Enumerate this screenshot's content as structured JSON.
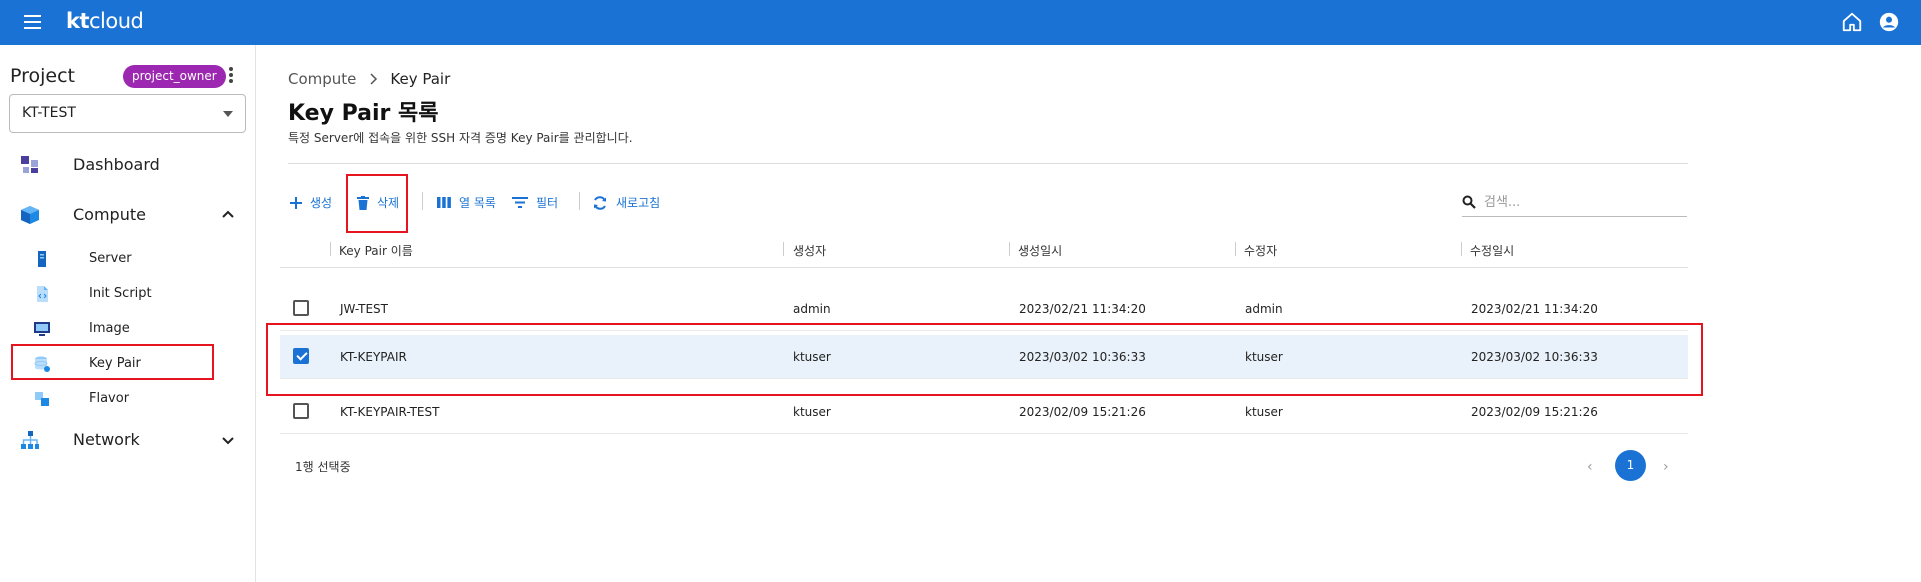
{
  "app": {
    "brand": "kt",
    "brand_suffix": "cloud",
    "accent": "#1a73d4"
  },
  "sidebar": {
    "project_label": "Project",
    "role_badge": "project_owner",
    "project_value": "KT-TEST",
    "items": [
      {
        "label": "Dashboard",
        "icon": "dashboard-icon"
      },
      {
        "label": "Compute",
        "icon": "compute-cube-icon",
        "expanded": true,
        "children": [
          {
            "label": "Server",
            "icon": "server-icon"
          },
          {
            "label": "Init Script",
            "icon": "script-file-icon"
          },
          {
            "label": "Image",
            "icon": "monitor-icon"
          },
          {
            "label": "Key Pair",
            "icon": "database-key-icon",
            "highlighted": true
          },
          {
            "label": "Flavor",
            "icon": "flavor-icon"
          }
        ]
      },
      {
        "label": "Network",
        "icon": "network-icon",
        "expanded": false
      }
    ]
  },
  "main": {
    "breadcrumb": [
      "Compute",
      "Key Pair"
    ],
    "title": "Key Pair 목록",
    "description": "특정 Server에 접속을 위한 SSH 자격 증명 Key Pair를 관리합니다.",
    "toolbar": {
      "create": "생성",
      "delete": "삭제",
      "columns": "열 목록",
      "filter": "필터",
      "refresh": "새로고침",
      "search_placeholder": "검색..."
    },
    "table": {
      "headers": [
        "Key Pair 이름",
        "생성자",
        "생성일시",
        "수정자",
        "수정일시"
      ],
      "rows": [
        {
          "checked": false,
          "name": "JW-TEST",
          "creator": "admin",
          "created": "2023/02/21 11:34:20",
          "modifier": "admin",
          "modified": "2023/02/21 11:34:20"
        },
        {
          "checked": true,
          "name": "KT-KEYPAIR",
          "creator": "ktuser",
          "created": "2023/03/02 10:36:33",
          "modifier": "ktuser",
          "modified": "2023/03/02 10:36:33"
        },
        {
          "checked": false,
          "name": "KT-KEYPAIR-TEST",
          "creator": "ktuser",
          "created": "2023/02/09 15:21:26",
          "modifier": "ktuser",
          "modified": "2023/02/09 15:21:26"
        }
      ]
    },
    "selection_status": "1행 선택중",
    "pagination": {
      "current": "1",
      "prev": "‹",
      "next": "›"
    }
  }
}
